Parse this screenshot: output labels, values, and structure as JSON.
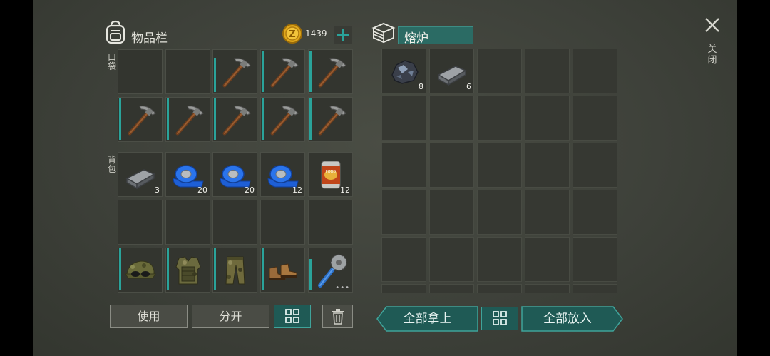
{
  "inventory": {
    "title": "物品栏",
    "coins": "1439",
    "section_pockets": "口袋",
    "section_backpack": "背包",
    "pocket_slots": [
      {
        "item": "",
        "count": ""
      },
      {
        "item": "",
        "count": ""
      },
      {
        "item": "pickaxe-icon",
        "count": ""
      },
      {
        "item": "pickaxe-icon",
        "count": ""
      },
      {
        "item": "pickaxe-icon",
        "count": ""
      },
      {
        "item": "pickaxe-icon",
        "count": ""
      },
      {
        "item": "pickaxe-icon",
        "count": ""
      },
      {
        "item": "pickaxe-icon",
        "count": ""
      },
      {
        "item": "pickaxe-icon",
        "count": ""
      },
      {
        "item": "pickaxe-icon",
        "count": ""
      }
    ],
    "backpack_slots": [
      {
        "item": "iron-bar-icon",
        "count": "3"
      },
      {
        "item": "blue-tape-icon",
        "count": "20"
      },
      {
        "item": "blue-tape-icon",
        "count": "20"
      },
      {
        "item": "blue-tape-icon",
        "count": "12"
      },
      {
        "item": "food-can-icon",
        "count": "12"
      },
      {
        "item": "",
        "count": ""
      },
      {
        "item": "",
        "count": ""
      },
      {
        "item": "",
        "count": ""
      },
      {
        "item": "",
        "count": ""
      },
      {
        "item": "",
        "count": ""
      },
      {
        "item": "military-cap-icon",
        "count": ""
      },
      {
        "item": "camo-vest-icon",
        "count": ""
      },
      {
        "item": "camo-pants-icon",
        "count": ""
      },
      {
        "item": "boots-icon",
        "count": ""
      },
      {
        "item": "saw-mace-icon",
        "count": ""
      }
    ],
    "use_label": "使用",
    "split_label": "分开"
  },
  "furnace": {
    "title": "熔炉",
    "slots": [
      {
        "item": "iron-ore-icon",
        "count": "8"
      },
      {
        "item": "iron-bar-icon",
        "count": "6"
      }
    ],
    "take_all_label": "全部拿上",
    "put_all_label": "全部放入"
  },
  "close_label": "关闭",
  "colors": {
    "accent": "#2aa39a",
    "accent_dark": "#1f5a55",
    "background": "#3e413a"
  }
}
